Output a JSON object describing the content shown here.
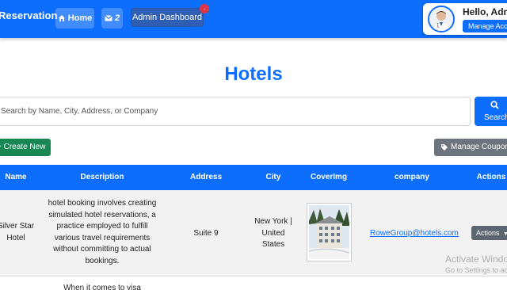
{
  "navbar": {
    "brand": "Reservation",
    "home_label": "Home",
    "messages_count": "2",
    "admin_dashboard_label": "Admin Dashboard",
    "notification_badge": "..",
    "greeting": "Hello, Admin",
    "manage_account_label": "Manage Account"
  },
  "page": {
    "title": "Hotels"
  },
  "search": {
    "placeholder": "Search by Name, City, Address, or Company",
    "button_label": "Search"
  },
  "toolbar": {
    "create_label": "+ Create New",
    "coupons_label": "Manage Coupons"
  },
  "table": {
    "headers": [
      "Name",
      "Description",
      "Address",
      "City",
      "CoverImg",
      "company",
      "Actions"
    ],
    "rows": [
      {
        "name": "Silver Star Hotel",
        "description": "hotel booking involves creating simulated hotel reservations, a practice employed to fulfill various travel requirements without committing to actual bookings.",
        "address": "Suite 9",
        "city": "New York | United States",
        "company": "RoweGroup@hotels.com",
        "actions_label": "Actions"
      }
    ],
    "next_row_partial": "When it comes to visa"
  },
  "watermark": {
    "line1": "Activate Windows",
    "line2": "Go to Settings to activate Windows."
  },
  "colors": {
    "primary": "#0d6efd",
    "success": "#198754",
    "secondary": "#6c757d",
    "danger": "#dc3545"
  }
}
